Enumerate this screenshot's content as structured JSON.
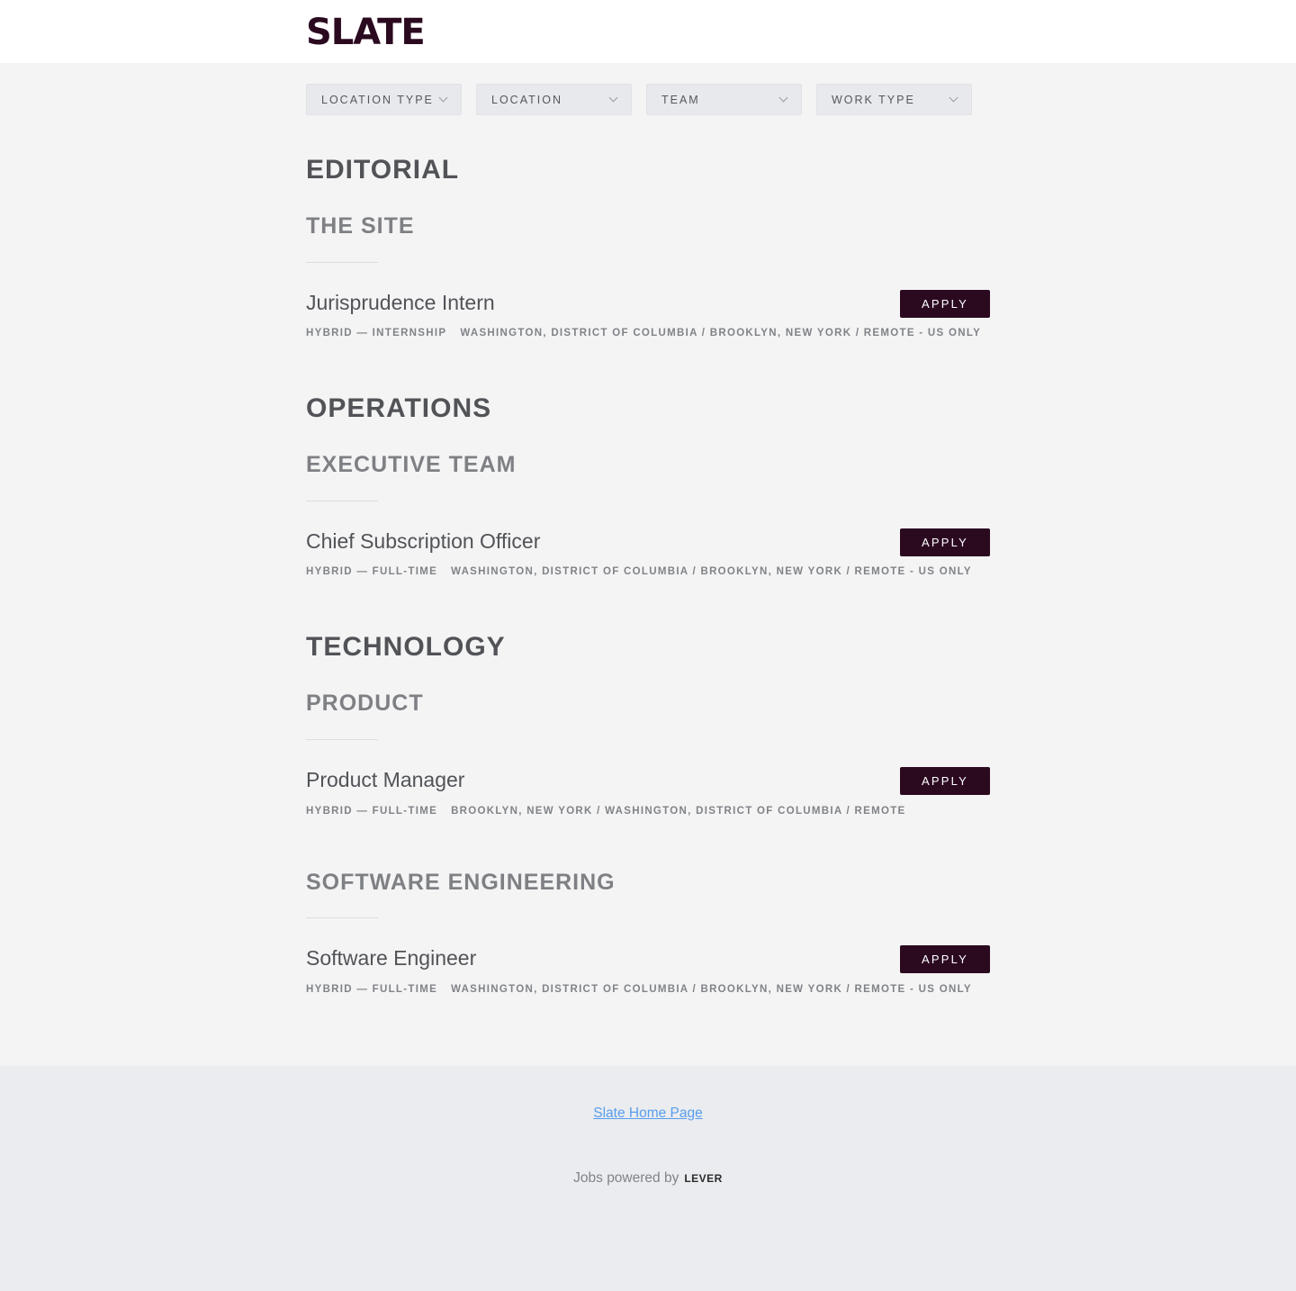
{
  "header": {
    "logo_text": "SLATE"
  },
  "filters": [
    {
      "label": "LOCATION TYPE"
    },
    {
      "label": "LOCATION"
    },
    {
      "label": "TEAM"
    },
    {
      "label": "WORK TYPE"
    }
  ],
  "postings": {
    "editorial": {
      "department": "EDITORIAL",
      "team": "THE SITE",
      "job": {
        "title": "Jurisprudence Intern",
        "commitment": "HYBRID — INTERNSHIP",
        "location": "WASHINGTON, DISTRICT OF COLUMBIA / BROOKLYN, NEW YORK / REMOTE - US ONLY",
        "apply_label": "APPLY"
      }
    },
    "operations": {
      "department": "OPERATIONS",
      "team": "EXECUTIVE TEAM",
      "job": {
        "title": "Chief Subscription Officer",
        "commitment": "HYBRID — FULL-TIME",
        "location": "WASHINGTON, DISTRICT OF COLUMBIA / BROOKLYN, NEW YORK / REMOTE - US ONLY",
        "apply_label": "APPLY"
      }
    },
    "technology": {
      "department": "TECHNOLOGY",
      "team_product": "PRODUCT",
      "product_job": {
        "title": "Product Manager",
        "commitment": "HYBRID — FULL-TIME",
        "location": "BROOKLYN, NEW YORK / WASHINGTON, DISTRICT OF COLUMBIA / REMOTE",
        "apply_label": "APPLY"
      },
      "team_software": "SOFTWARE ENGINEERING",
      "software_job": {
        "title": "Software Engineer",
        "commitment": "HYBRID — FULL-TIME",
        "location": "WASHINGTON, DISTRICT OF COLUMBIA / BROOKLYN, NEW YORK / REMOTE - US ONLY",
        "apply_label": "APPLY"
      }
    }
  },
  "footer": {
    "home_link": "Slate Home Page",
    "powered_by": "Jobs powered by",
    "lever_logo": "LEVER"
  },
  "colors": {
    "brand": "#2b0a20",
    "link": "#579eee",
    "background": "#f4f4f5",
    "footer_background": "#ebecef"
  }
}
